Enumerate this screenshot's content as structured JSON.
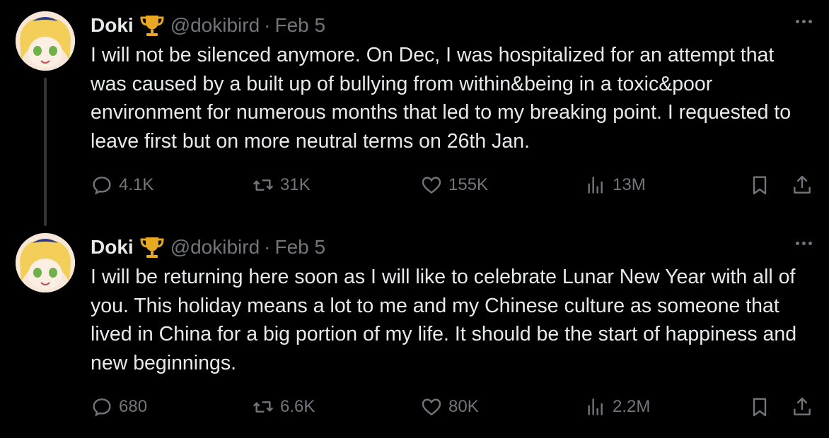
{
  "tweets": [
    {
      "author": {
        "name": "Doki",
        "handle": "@dokibird",
        "date": "Feb 5",
        "badge": "trophy-icon"
      },
      "text": "I will not be silenced anymore. On Dec, I was hospitalized for an attempt that was caused by a built up of bullying from within&being in a toxic&poor environment for numerous months that led to my breaking point. I requested to leave first but on more neutral terms on 26th Jan.",
      "stats": {
        "replies": "4.1K",
        "reposts": "31K",
        "likes": "155K",
        "views": "13M"
      }
    },
    {
      "author": {
        "name": "Doki",
        "handle": "@dokibird",
        "date": "Feb 5",
        "badge": "trophy-icon"
      },
      "text": "I will be returning here soon as I will like to celebrate Lunar New Year with all of you. This holiday means a lot to me and my Chinese culture as someone that lived in China for a big portion of my life. It should be the start of happiness and new beginnings.",
      "stats": {
        "replies": "680",
        "reposts": "6.6K",
        "likes": "80K",
        "views": "2.2M"
      }
    }
  ],
  "separator": "·",
  "colors": {
    "background": "#000000",
    "text": "#e7e9ea",
    "muted": "#71767b",
    "thread_line": "#333639",
    "badge_gold": "#e8a823"
  }
}
